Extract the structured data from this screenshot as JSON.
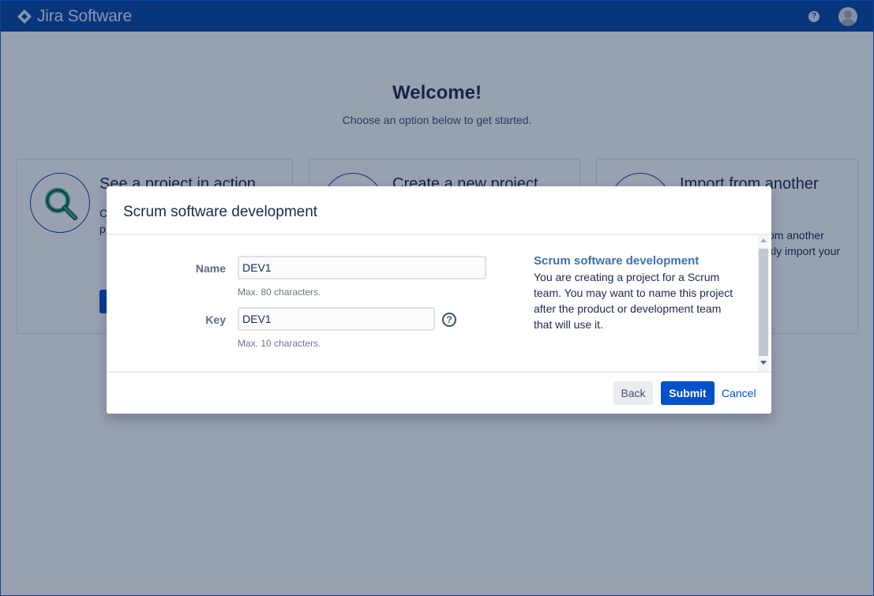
{
  "topbar": {
    "product_name": "Jira Software",
    "help_glyph": "?",
    "colors": {
      "nav": "#0747a6"
    }
  },
  "welcome": {
    "title": "Welcome!",
    "subtitle": "Choose an option below to get started.",
    "cards": [
      {
        "title": "See a project in action",
        "text_lines": [
          "C",
          "p"
        ],
        "icon": "magnifier-icon"
      },
      {
        "title": "Create a new project",
        "icon": "plus-icon"
      },
      {
        "title": "Import from another",
        "text_lines": [
          "om another",
          "kly import your"
        ],
        "icon": "rocket-icon"
      }
    ]
  },
  "modal": {
    "title": "Scrum software development",
    "form": {
      "name_label": "Name",
      "name_value": "DEV1",
      "name_hint": "Max. 80 characters.",
      "key_label": "Key",
      "key_value": "DEV1",
      "key_hint": "Max. 10 characters.",
      "key_help_glyph": "?"
    },
    "description": {
      "title": "Scrum software development",
      "text": "You are creating a project for a Scrum team. You may want to name this project after the product or development team that will use it."
    },
    "footer": {
      "back_label": "Back",
      "submit_label": "Submit",
      "cancel_label": "Cancel"
    }
  }
}
